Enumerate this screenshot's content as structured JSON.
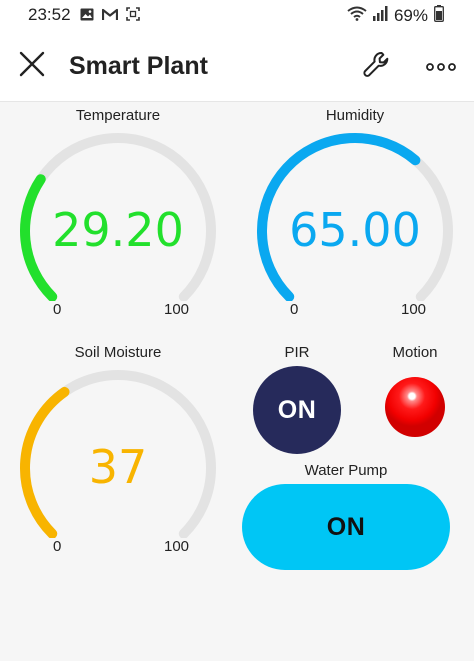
{
  "status_bar": {
    "time": "23:52",
    "battery": "69%",
    "icons_left": [
      "gallery-icon",
      "gmail-icon",
      "screenshot-icon"
    ],
    "icons_right": [
      "wifi-icon",
      "signal-icon",
      "battery-icon"
    ]
  },
  "header": {
    "title": "Smart Plant",
    "close_icon": "close-icon",
    "settings_icon": "wrench-icon",
    "more_icon": "more-icon"
  },
  "gauges": {
    "temperature": {
      "label": "Temperature",
      "value_text": "29.20",
      "value": 29.2,
      "min": "0",
      "max": "100",
      "min_value": 0,
      "max_value": 100,
      "color": "#22e02c"
    },
    "humidity": {
      "label": "Humidity",
      "value_text": "65.00",
      "value": 65,
      "min": "0",
      "max": "100",
      "min_value": 0,
      "max_value": 100,
      "color": "#0aa8f0"
    },
    "soil_moisture": {
      "label": "Soil Moisture",
      "value_text": "37",
      "value": 37,
      "min": "0",
      "max": "100",
      "min_value": 0,
      "max_value": 100,
      "color": "#f8b400"
    }
  },
  "pir": {
    "label": "PIR",
    "state": "ON",
    "color": "#262a5b"
  },
  "motion": {
    "label": "Motion",
    "color": "#ff1010"
  },
  "water_pump": {
    "label": "Water Pump",
    "state": "ON",
    "color": "#00c6f5"
  },
  "colors": {
    "track": "#e3e3e3",
    "background": "#f6f6f6"
  }
}
